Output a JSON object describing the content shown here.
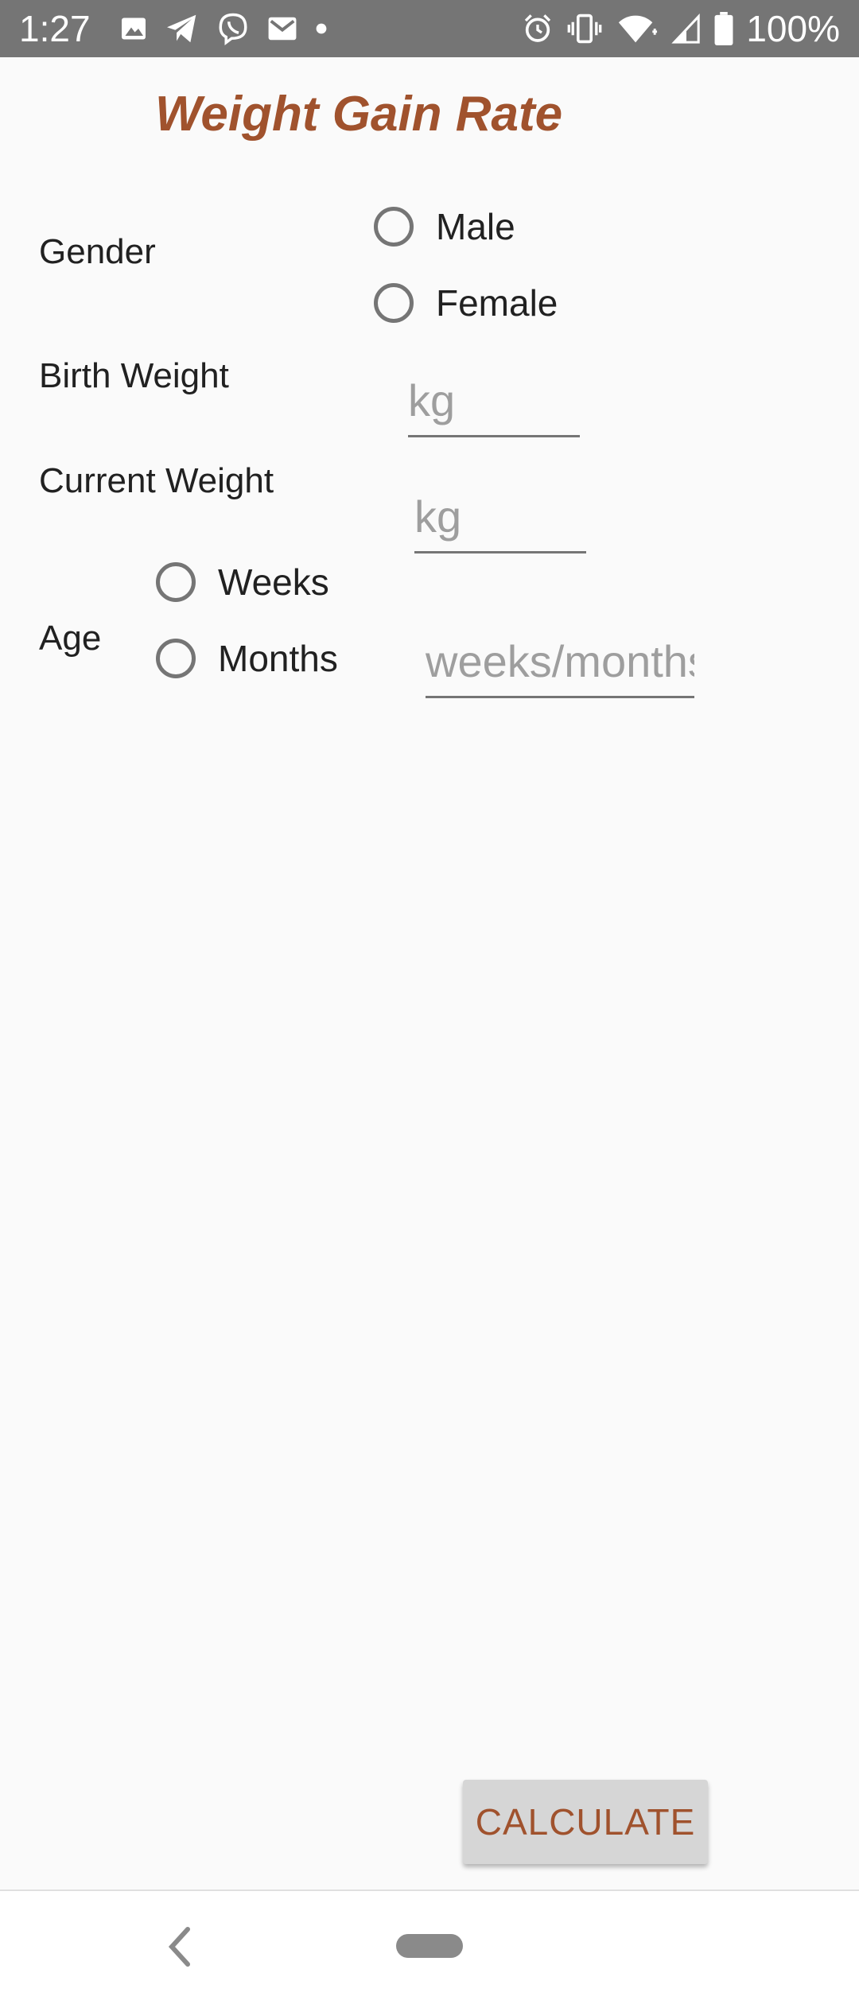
{
  "status_bar": {
    "time": "1:27",
    "battery_text": "100%",
    "icons_left": [
      "image-icon",
      "telegram-icon",
      "viber-icon",
      "gmail-icon",
      "dot-icon"
    ],
    "icons_right": [
      "alarm-icon",
      "vibrate-icon",
      "wifi-icon",
      "signal-icon",
      "battery-icon"
    ]
  },
  "app": {
    "title": "Weight Gain Rate",
    "accent_color": "#a0522d"
  },
  "form": {
    "gender": {
      "label": "Gender",
      "options": [
        "Male",
        "Female"
      ],
      "selected": null
    },
    "birth_weight": {
      "label": "Birth Weight",
      "value": "",
      "placeholder": "kg"
    },
    "current_weight": {
      "label": "Current Weight",
      "value": "",
      "placeholder": "kg"
    },
    "age": {
      "label": "Age",
      "options": [
        "Weeks",
        "Months"
      ],
      "selected": null,
      "value": "",
      "placeholder": "weeks/months"
    }
  },
  "actions": {
    "calculate_label": "CALCULATE"
  },
  "nav_bar": {
    "icons": [
      "back-icon",
      "home-pill-icon"
    ]
  }
}
